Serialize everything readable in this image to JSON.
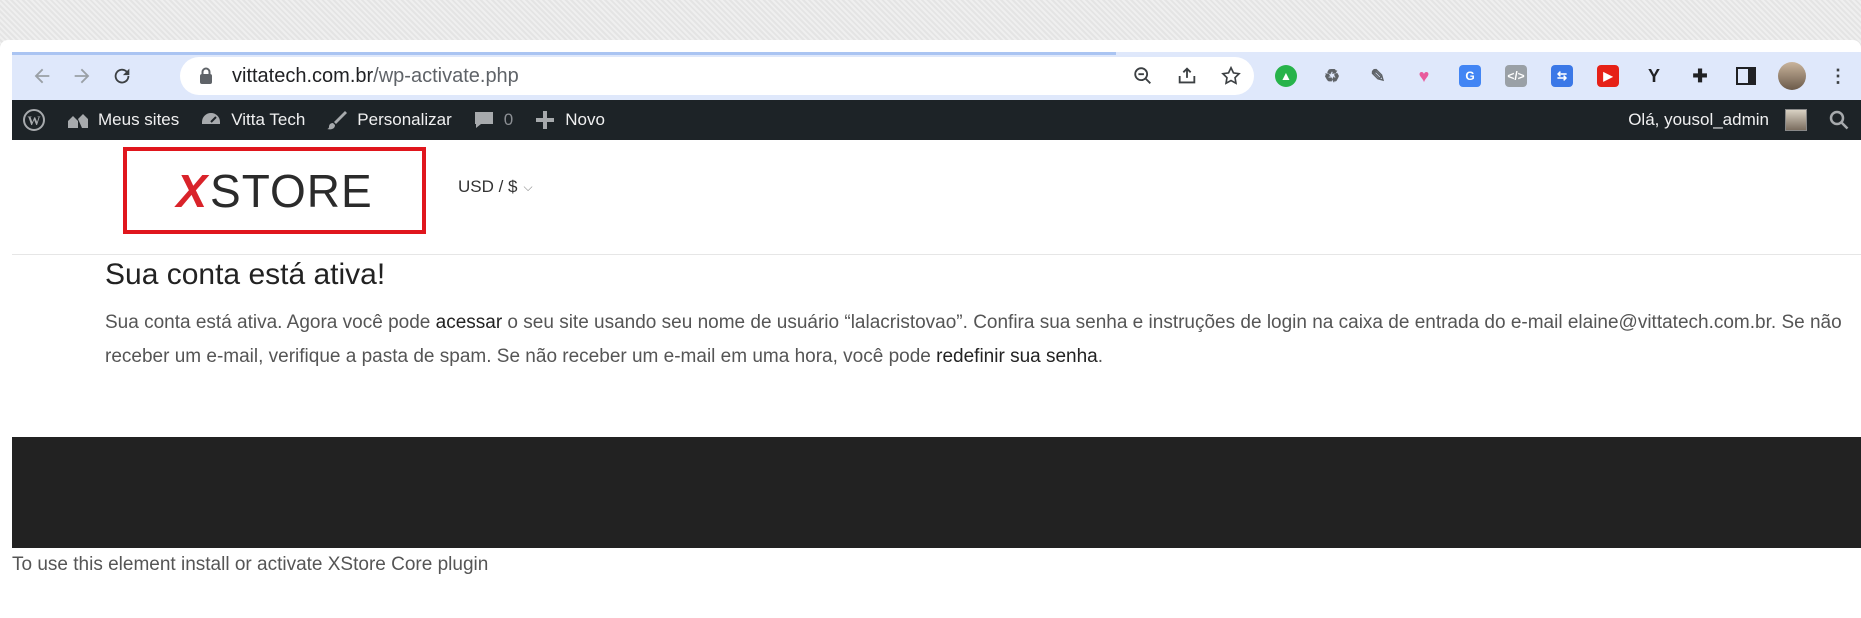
{
  "browser": {
    "url_host": "vittatech.com.br",
    "url_path": "/wp-activate.php"
  },
  "admin_bar": {
    "my_sites": "Meus sites",
    "site_name": "Vitta Tech",
    "customize": "Personalizar",
    "comments_count": "0",
    "new": "Novo",
    "greeting": "Olá, yousol_admin"
  },
  "header": {
    "logo_mark": "X",
    "logo_text": "STORE",
    "currency": "USD / $"
  },
  "content": {
    "title": "Sua conta está ativa!",
    "p1": "Sua conta está ativa. Agora você pode ",
    "link_access": "acessar",
    "p2": " o seu site usando seu nome de usuário “lalacristovao”. Confira sua senha e instruções de login na caixa de entrada do e-mail elaine@vittatech.com.br. Se não receber um e-mail, verifique a pasta de spam. Se não receber um e-mail em uma hora, você pode ",
    "link_reset": "redefinir sua senha",
    "p3": "."
  },
  "footer": {
    "plugin_note": "To use this element install or activate XStore Core plugin"
  },
  "colors": {
    "admin_bar_bg": "#1d2327",
    "toolbar_bg": "#dfe8fb",
    "logo_accent": "#d9232a",
    "highlight_box": "#e0161d",
    "footer_bg": "#222222"
  }
}
